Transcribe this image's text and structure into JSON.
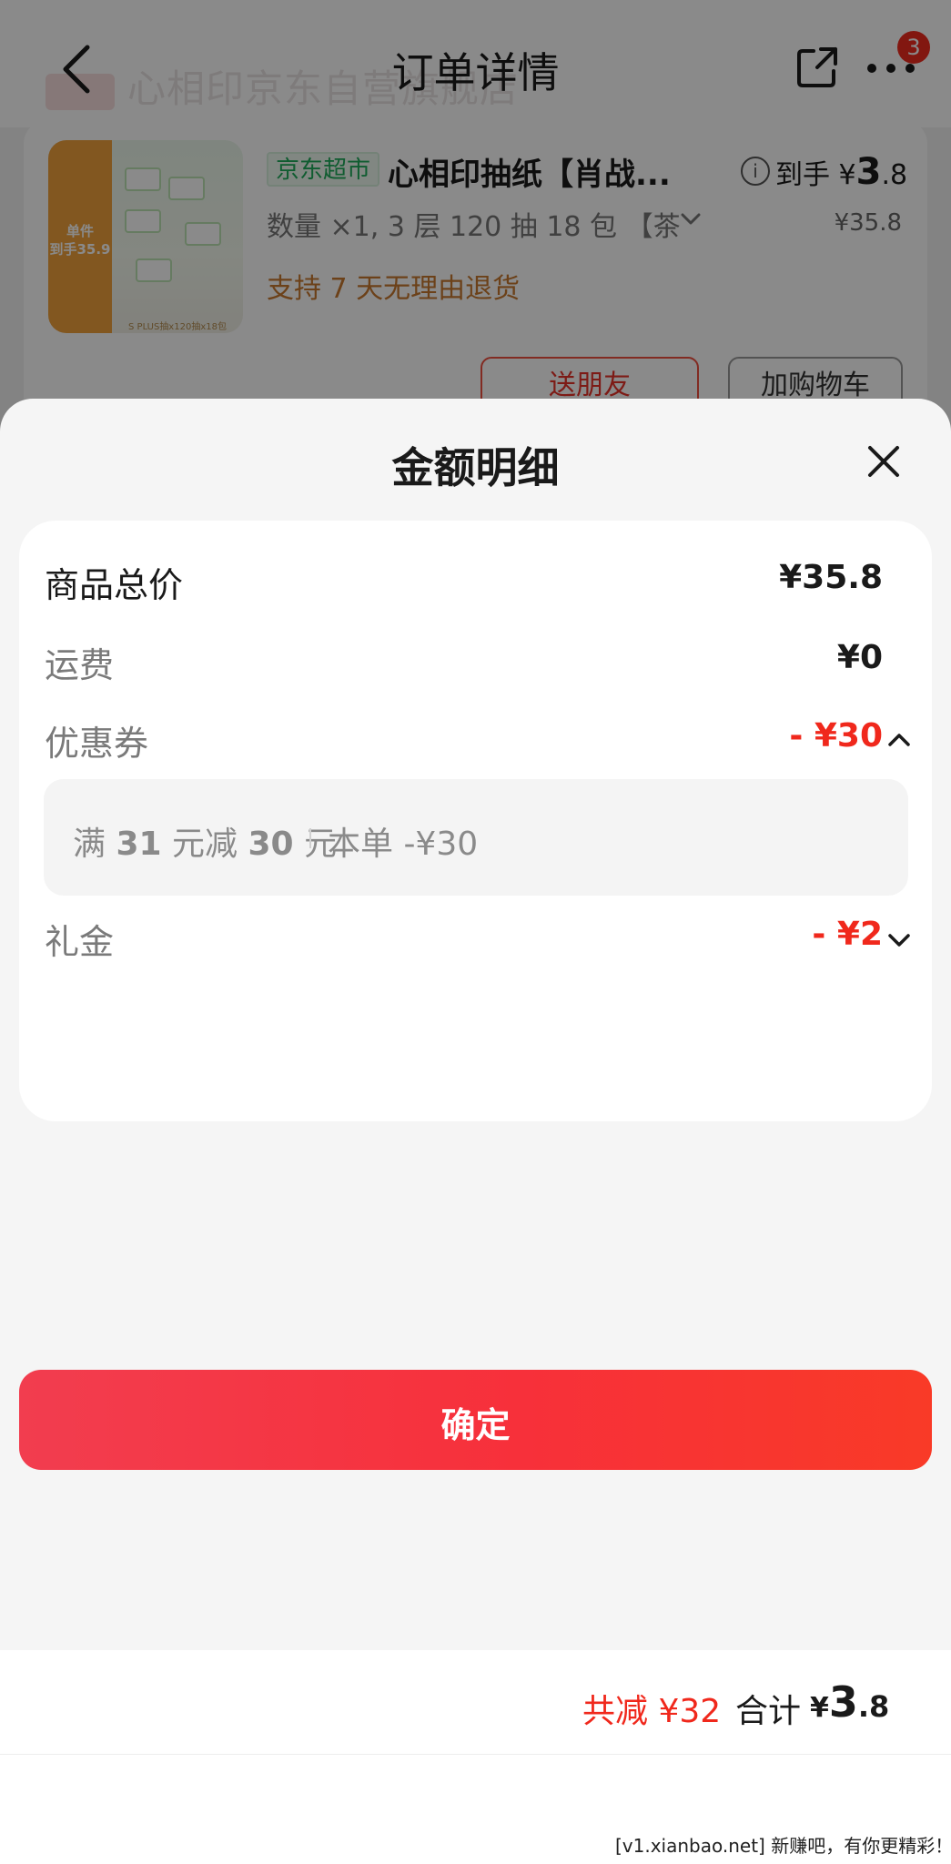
{
  "order_page": {
    "nav_title": "订单详情",
    "notification_count": "3",
    "header_ghost_text": "心相印京东自营旗舰店",
    "product": {
      "tag": "京东超市",
      "name": "心相印抽纸【肖战...",
      "arrive_label": "到手",
      "arrive_currency": "¥",
      "arrive_int": "3",
      "arrive_dec": ".8",
      "original_price": "¥35.8",
      "spec": "数量 ×1, 3 层 120 抽 18 包 【茶",
      "return_policy": "支持 7 天无理由退货",
      "thumb_promo_line1": "单件",
      "thumb_promo_line2": "到手35.9",
      "thumb_caption": "S PLUS抽x120抽x18包"
    },
    "buttons": {
      "gift": "送朋友",
      "cart": "加购物车"
    }
  },
  "sheet": {
    "title": "金额明细",
    "rows": [
      {
        "label": "商品总价",
        "value": "¥35.8"
      },
      {
        "label": "运费",
        "value": "¥0"
      },
      {
        "label": "优惠券",
        "value": "- ¥30"
      },
      {
        "label": "礼金",
        "value": "- ¥2"
      }
    ],
    "coupon_detail": {
      "prefix": "满",
      "threshold": "31",
      "middle": "元减",
      "discount": "30",
      "suffix": "元",
      "applied": "本单 -¥30"
    },
    "total": {
      "reduce": "共减 ¥32",
      "label": "合计",
      "currency": "¥",
      "int": "3",
      "dec": ".8"
    },
    "confirm_label": "确定"
  },
  "watermark": "[v1.xianbao.net] 新赚吧，有你更精彩！",
  "colors": {
    "accent_red": "#f0281c",
    "tag_green": "#1eaa5a",
    "return_orange": "#c7792f"
  }
}
